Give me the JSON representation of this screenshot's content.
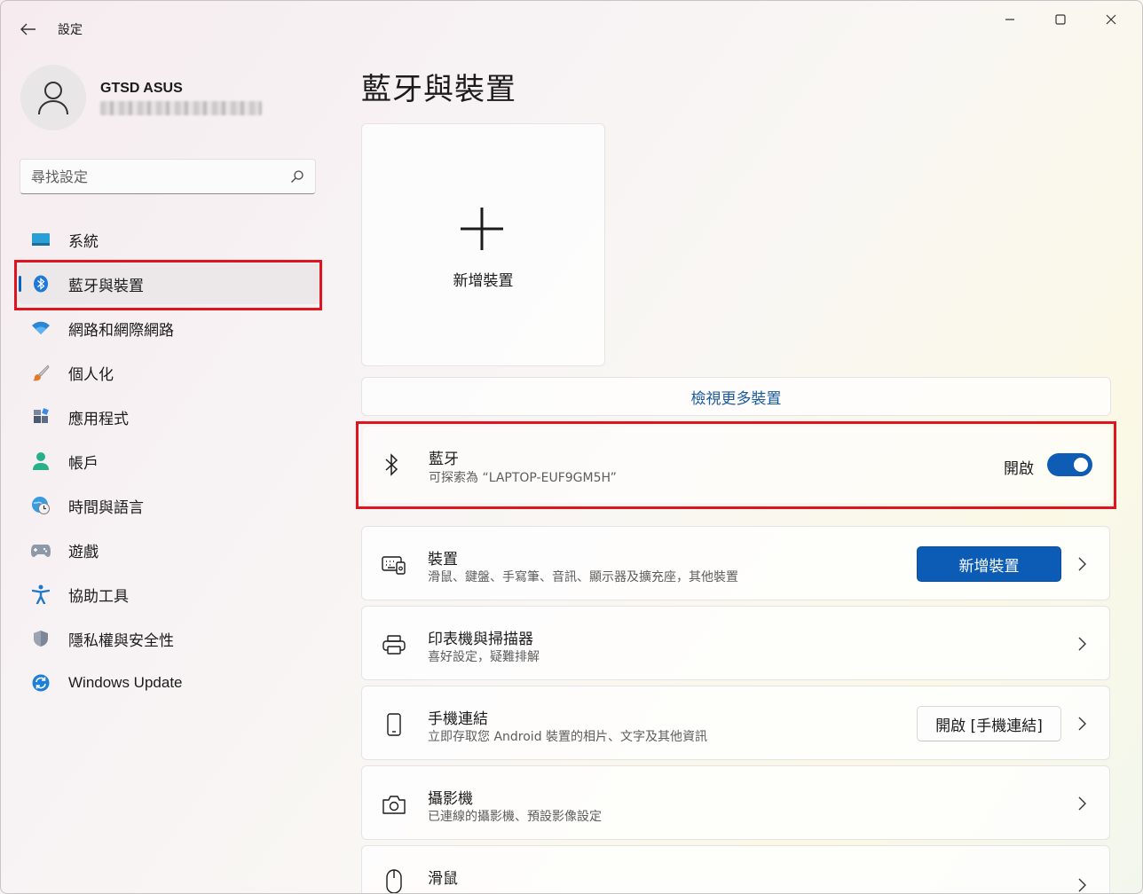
{
  "window": {
    "title": "設定",
    "icons": {
      "back": "back-arrow-icon",
      "minimize": "minimize-icon",
      "maximize": "maximize-icon",
      "close": "close-icon"
    }
  },
  "profile": {
    "name": "GTSD ASUS",
    "icon": "user-avatar-icon"
  },
  "search": {
    "placeholder": "尋找設定",
    "icon": "search-icon"
  },
  "sidebar": {
    "items": [
      {
        "label": "系統",
        "icon": "system-monitor-icon",
        "active": false
      },
      {
        "label": "藍牙與裝置",
        "icon": "bluetooth-icon",
        "active": true
      },
      {
        "label": "網路和網際網路",
        "icon": "wifi-icon",
        "active": false
      },
      {
        "label": "個人化",
        "icon": "paintbrush-icon",
        "active": false
      },
      {
        "label": "應用程式",
        "icon": "apps-icon",
        "active": false
      },
      {
        "label": "帳戶",
        "icon": "account-icon",
        "active": false
      },
      {
        "label": "時間與語言",
        "icon": "globe-clock-icon",
        "active": false
      },
      {
        "label": "遊戲",
        "icon": "gamepad-icon",
        "active": false
      },
      {
        "label": "協助工具",
        "icon": "accessibility-icon",
        "active": false
      },
      {
        "label": "隱私權與安全性",
        "icon": "shield-icon",
        "active": false
      },
      {
        "label": "Windows Update",
        "icon": "windows-update-icon",
        "active": false
      }
    ]
  },
  "main": {
    "title": "藍牙與裝置",
    "add_tile": {
      "label": "新增裝置",
      "icon": "plus-icon"
    },
    "more_devices": "檢視更多裝置",
    "bluetooth": {
      "title": "藍牙",
      "subtitle": "可探索為 “LAPTOP-EUF9GM5H”",
      "toggle_label": "開啟",
      "on": true,
      "icon": "bluetooth-icon"
    },
    "cards": [
      {
        "title": "裝置",
        "subtitle": "滑鼠、鍵盤、手寫筆、音訊、顯示器及擴充座，其他裝置",
        "button": "新增裝置",
        "icon": "keyboard-device-icon"
      },
      {
        "title": "印表機與掃描器",
        "subtitle": "喜好設定，疑難排解",
        "icon": "printer-icon"
      },
      {
        "title": "手機連結",
        "subtitle": "立即存取您 Android 裝置的相片、文字及其他資訊",
        "button": "開啟 [手機連結]",
        "icon": "phone-icon"
      },
      {
        "title": "攝影機",
        "subtitle": "已連線的攝影機、預設影像設定",
        "icon": "camera-icon"
      },
      {
        "title": "滑鼠",
        "icon": "mouse-icon"
      }
    ]
  },
  "colors": {
    "accent": "#0067c0",
    "highlight": "#e0141f",
    "toggle_on": "#0f5cb5"
  }
}
